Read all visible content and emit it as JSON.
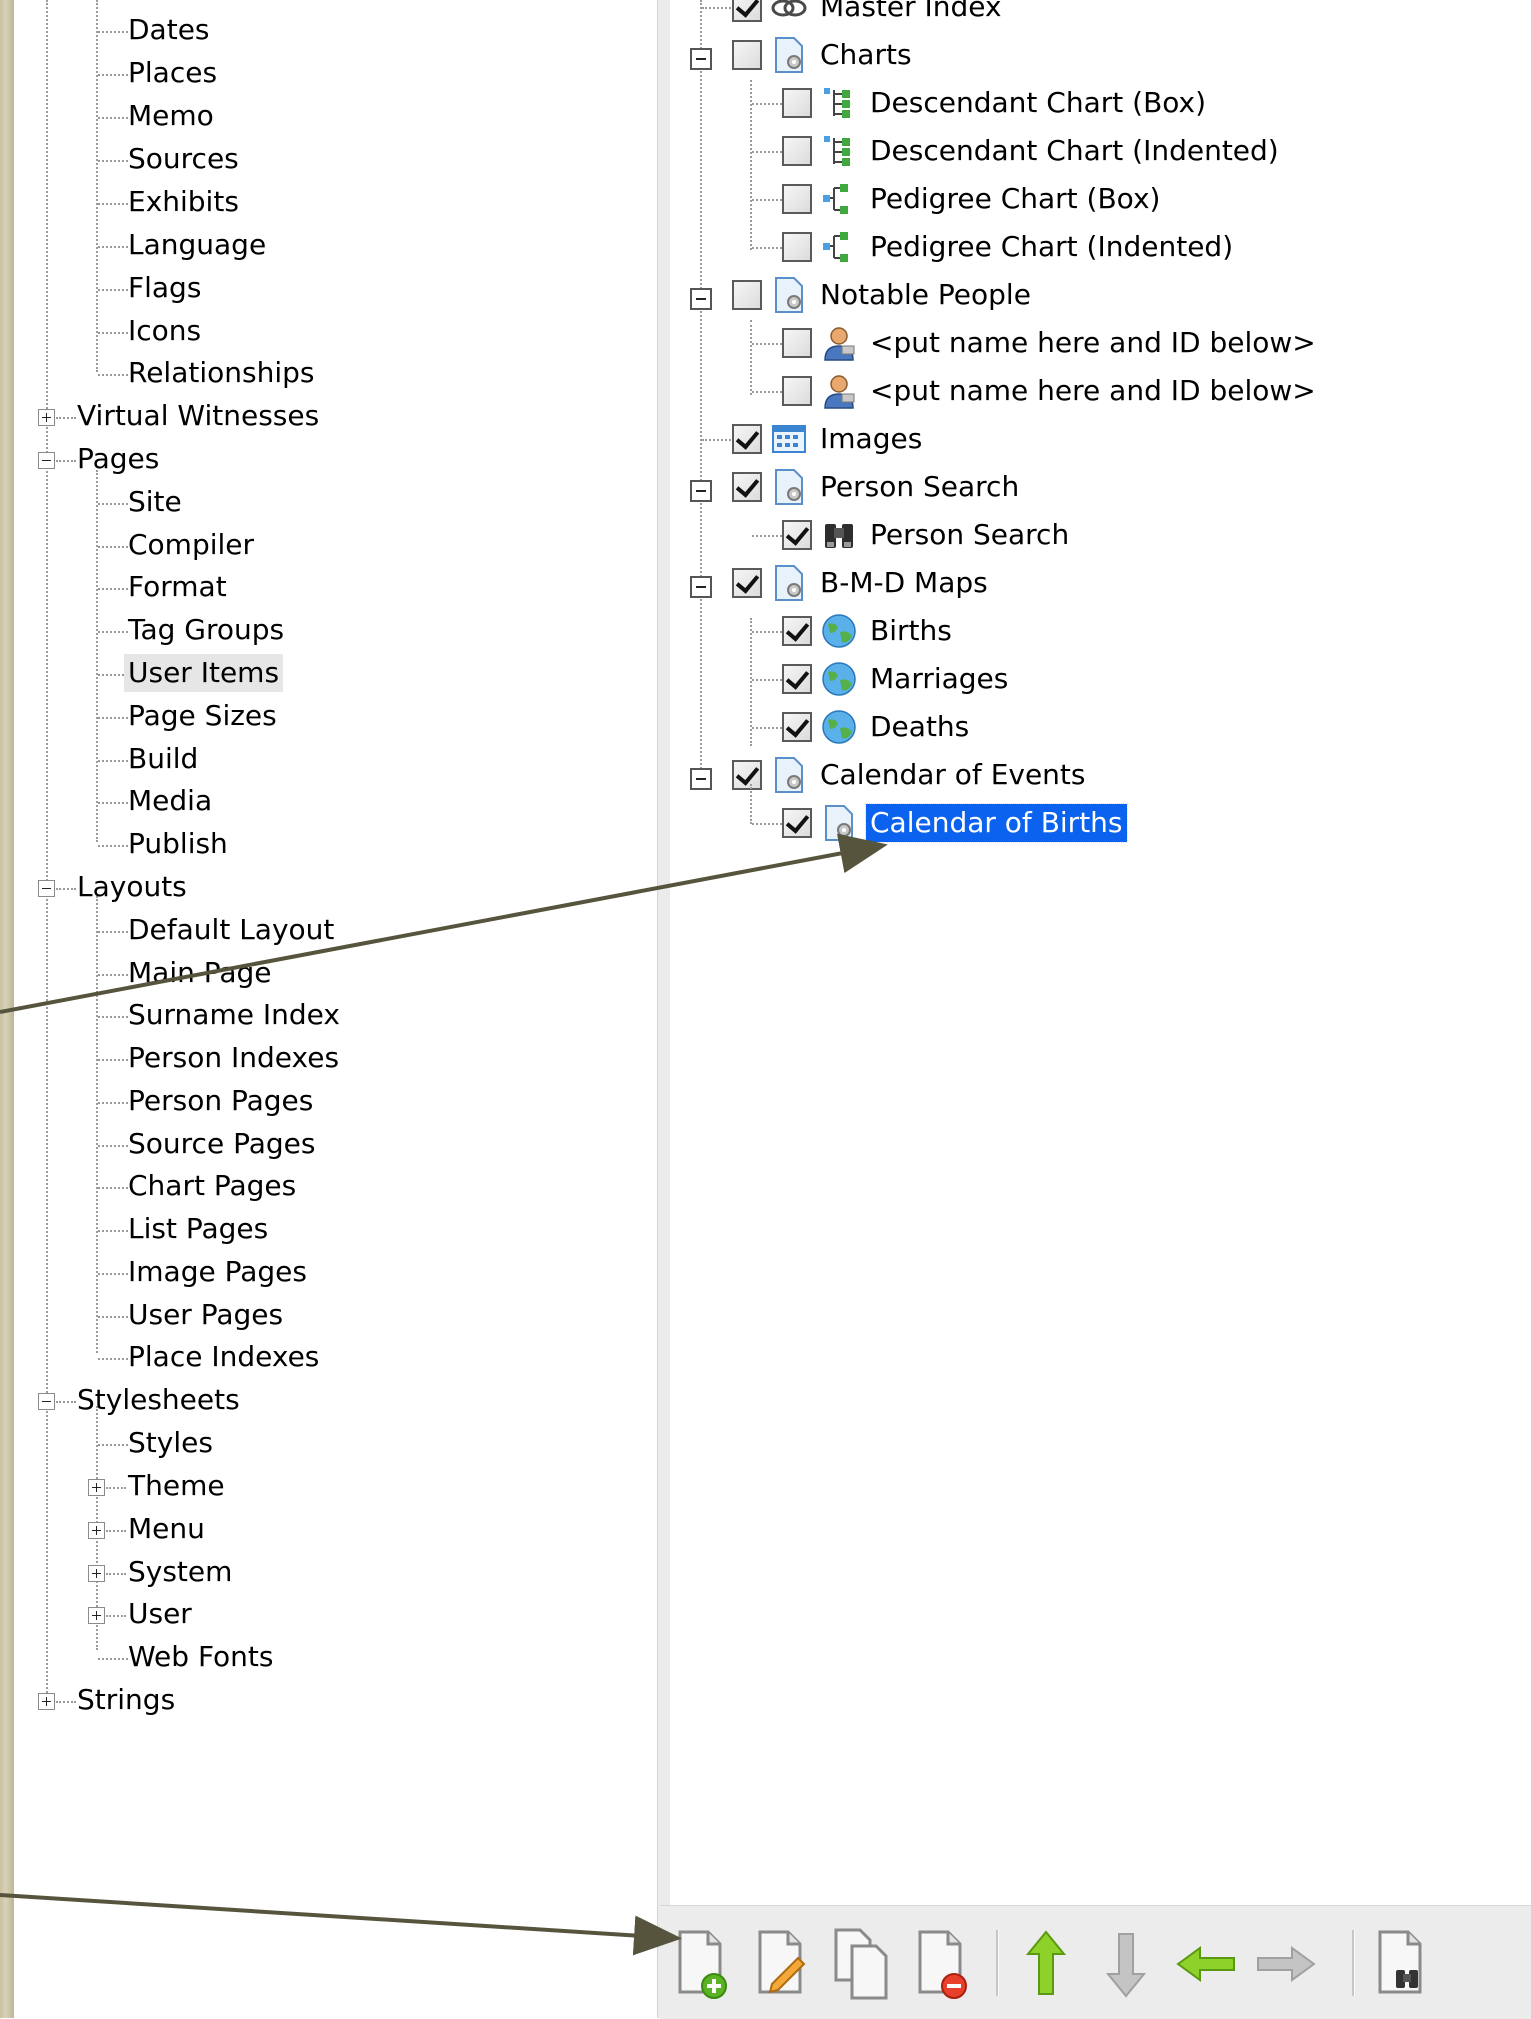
{
  "left_tree": {
    "items": [
      {
        "label": "Dates"
      },
      {
        "label": "Places"
      },
      {
        "label": "Memo"
      },
      {
        "label": "Sources"
      },
      {
        "label": "Exhibits"
      },
      {
        "label": "Language"
      },
      {
        "label": "Flags"
      },
      {
        "label": "Icons"
      },
      {
        "label": "Relationships"
      },
      {
        "label": "Virtual Witnesses",
        "expander": "plus"
      },
      {
        "label": "Pages",
        "expander": "minus"
      },
      {
        "label": "Site"
      },
      {
        "label": "Compiler"
      },
      {
        "label": "Format"
      },
      {
        "label": "Tag Groups"
      },
      {
        "label": "User Items",
        "state": "hover"
      },
      {
        "label": "Page Sizes"
      },
      {
        "label": "Build"
      },
      {
        "label": "Media"
      },
      {
        "label": "Publish"
      },
      {
        "label": "Layouts",
        "expander": "minus"
      },
      {
        "label": "Default Layout"
      },
      {
        "label": "Main Page"
      },
      {
        "label": "Surname Index"
      },
      {
        "label": "Person Indexes"
      },
      {
        "label": "Person Pages"
      },
      {
        "label": "Source Pages"
      },
      {
        "label": "Chart Pages"
      },
      {
        "label": "List Pages"
      },
      {
        "label": "Image Pages"
      },
      {
        "label": "User Pages"
      },
      {
        "label": "Place Indexes"
      },
      {
        "label": "Stylesheets",
        "expander": "minus"
      },
      {
        "label": "Styles"
      },
      {
        "label": "Theme",
        "expander": "plus"
      },
      {
        "label": "Menu",
        "expander": "plus"
      },
      {
        "label": "System",
        "expander": "plus"
      },
      {
        "label": "User",
        "expander": "plus"
      },
      {
        "label": "Web Fonts"
      },
      {
        "label": "Strings",
        "expander": "plus"
      }
    ]
  },
  "right_tree": {
    "items": [
      {
        "label": "Master Index",
        "checked": true,
        "icon": "link-icon"
      },
      {
        "label": "Charts",
        "checked": false,
        "icon": "page-gear-icon",
        "expander": "minus"
      },
      {
        "label": "Descendant Chart (Box)",
        "checked": false,
        "icon": "descendant-chart-icon"
      },
      {
        "label": "Descendant Chart (Indented)",
        "checked": false,
        "icon": "descendant-chart-icon"
      },
      {
        "label": "Pedigree Chart (Box)",
        "checked": false,
        "icon": "pedigree-chart-icon"
      },
      {
        "label": "Pedigree Chart (Indented)",
        "checked": false,
        "icon": "pedigree-chart-icon"
      },
      {
        "label": "Notable People",
        "checked": false,
        "icon": "page-gear-icon",
        "expander": "minus"
      },
      {
        "label": "<put name here and ID below>",
        "checked": false,
        "icon": "person-icon"
      },
      {
        "label": "<put name here and ID below>",
        "checked": false,
        "icon": "person-icon"
      },
      {
        "label": "Images",
        "checked": true,
        "icon": "image-grid-icon"
      },
      {
        "label": "Person Search",
        "checked": true,
        "icon": "page-gear-icon",
        "expander": "minus"
      },
      {
        "label": "Person Search",
        "checked": true,
        "icon": "binoculars-icon"
      },
      {
        "label": "B-M-D Maps",
        "checked": true,
        "icon": "page-gear-icon",
        "expander": "minus"
      },
      {
        "label": "Births",
        "checked": true,
        "icon": "globe-icon"
      },
      {
        "label": "Marriages",
        "checked": true,
        "icon": "globe-icon"
      },
      {
        "label": "Deaths",
        "checked": true,
        "icon": "globe-icon"
      },
      {
        "label": "Calendar of Events",
        "checked": true,
        "icon": "page-gear-icon",
        "expander": "minus"
      },
      {
        "label": "Calendar of Births",
        "checked": true,
        "icon": "page-gear-icon",
        "state": "selected"
      }
    ]
  },
  "toolbar": {
    "buttons": [
      {
        "icon": "add-page-icon"
      },
      {
        "icon": "edit-page-icon"
      },
      {
        "icon": "copy-page-icon"
      },
      {
        "icon": "delete-page-icon"
      },
      {
        "icon": "move-up-icon"
      },
      {
        "icon": "move-down-icon"
      },
      {
        "icon": "move-left-icon"
      },
      {
        "icon": "move-right-icon"
      },
      {
        "icon": "find-icon"
      }
    ]
  },
  "colors": {
    "selection": "#0a62ee",
    "arrow": "#56543d",
    "green": "#6eb51c",
    "hover": "#e6e6e6"
  }
}
